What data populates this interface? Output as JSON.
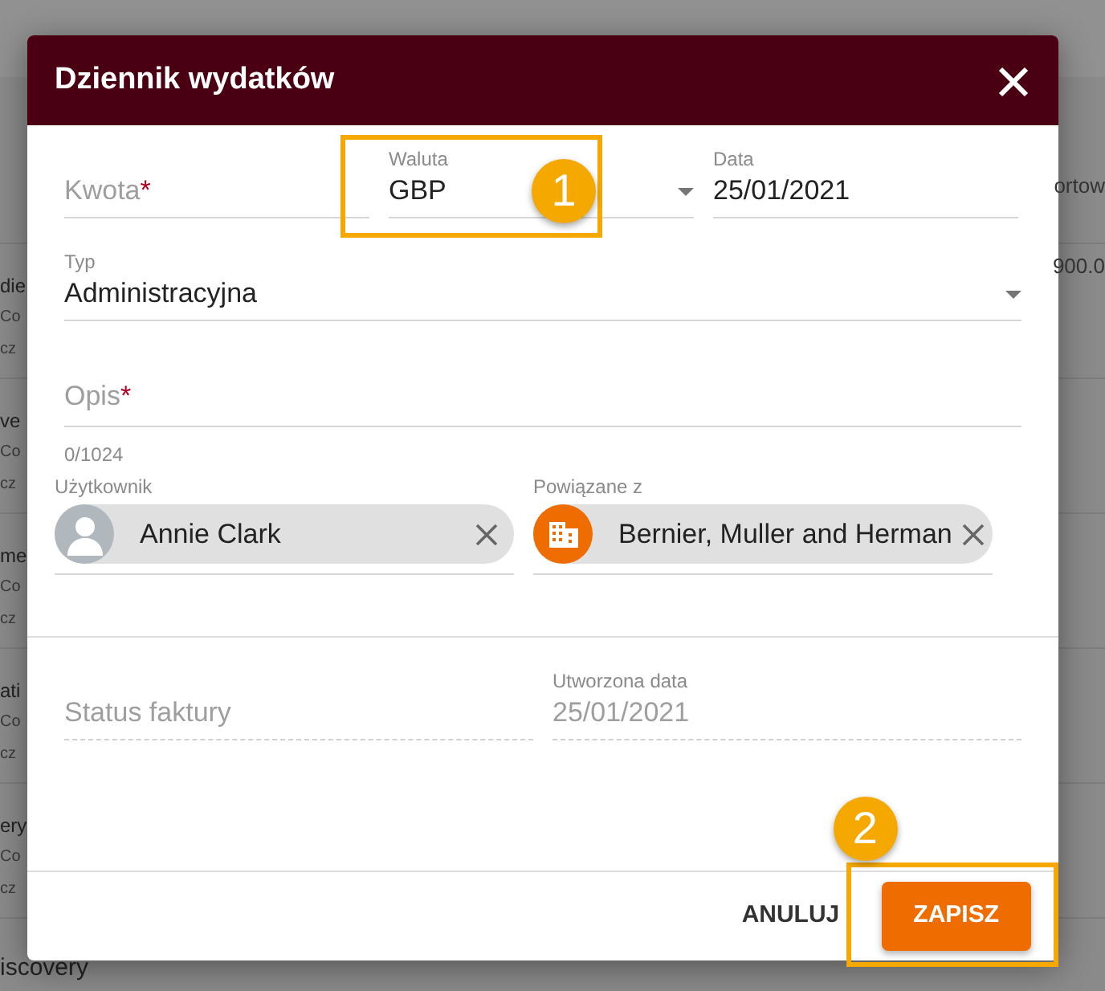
{
  "background": {
    "right_texts": [
      "ortow",
      "900.0"
    ],
    "left_rows": [
      {
        "lines": [
          "die",
          "Co",
          "cz"
        ]
      },
      {
        "lines": [
          "ve",
          "Co",
          "cz"
        ]
      },
      {
        "lines": [
          "me",
          "Co",
          "cz"
        ]
      },
      {
        "lines": [
          "ati",
          "Co",
          "cz"
        ]
      },
      {
        "lines": [
          "ery",
          "Co",
          "cz"
        ]
      }
    ],
    "bottom_title": "iscovery"
  },
  "dialog": {
    "title": "Dziennik wydatków",
    "fields": [
      {
        "kind": "input",
        "placeholder": "Kwota",
        "required_mark": "*"
      },
      {
        "kind": "select",
        "label": "Waluta",
        "value": "GBP",
        "callout": "1"
      },
      {
        "kind": "input",
        "label": "Data",
        "value": "25/01/2021"
      }
    ],
    "type_field": {
      "label": "Typ",
      "value": "Administracyjna"
    },
    "description": {
      "placeholder": "Opis",
      "required_mark": "*",
      "counter": "0/1024"
    },
    "chips": [
      {
        "label": "Użytkownik",
        "value": "Annie Clark",
        "kind": "person"
      },
      {
        "label": "Powiązane z",
        "value": "Bernier, Muller and Herman",
        "kind": "company"
      }
    ],
    "readonly": [
      {
        "placeholder": "Status faktury",
        "disabled": true
      },
      {
        "label": "Utworzona data",
        "value": "25/01/2021",
        "disabled": true
      }
    ],
    "buttons": [
      {
        "label": "ANULUJ",
        "kind": "text"
      },
      {
        "label": "ZAPISZ",
        "kind": "primary",
        "callout": "2"
      }
    ]
  }
}
